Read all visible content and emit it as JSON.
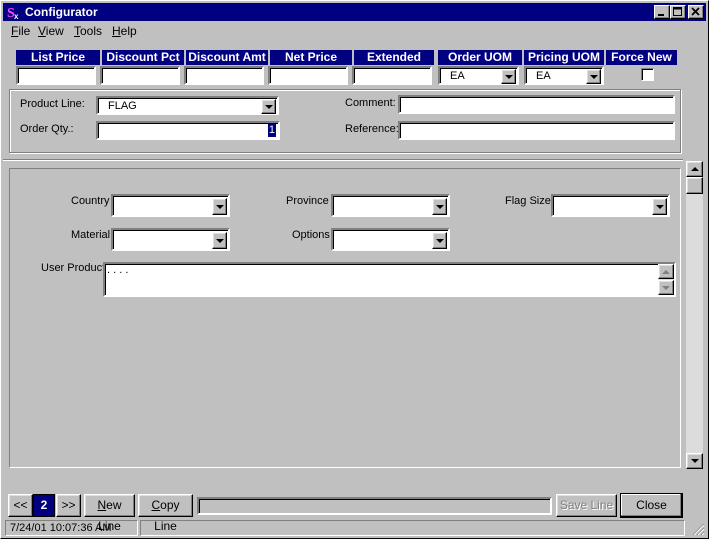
{
  "window": {
    "title": "Configurator",
    "minimize": "_",
    "maximize": "□",
    "close": "✕"
  },
  "menu": [
    {
      "label": "File",
      "accel": "F",
      "rest": "ile"
    },
    {
      "label": "View",
      "accel": "V",
      "rest": "iew"
    },
    {
      "label": "Tools",
      "accel": "T",
      "rest": "ools"
    },
    {
      "label": "Help",
      "accel": "H",
      "rest": "elp"
    }
  ],
  "line_header": {
    "list_price": "List Price",
    "discount_pct": "Discount Pct",
    "discount_amt": "Discount Amt",
    "net_price": "Net Price",
    "extended": "Extended",
    "order_uom": "Order UOM",
    "pricing_uom": "Pricing UOM",
    "force_new": "Force New"
  },
  "line_values": {
    "list_price": "",
    "discount_pct": "",
    "discount_amt": "",
    "net_price": "",
    "extended": "",
    "order_uom": "EA",
    "pricing_uom": "EA",
    "force_new": false
  },
  "product": {
    "product_line_label": "Product Line:",
    "product_line_value": "FLAG",
    "order_qty_label": "Order Qty.:",
    "order_qty_value": "1",
    "comment_label": "Comment:",
    "comment_value": "",
    "reference_label": "Reference:",
    "reference_value": ""
  },
  "options": {
    "country_label": "Country",
    "province_label": "Province",
    "flag_size_label": "Flag Size",
    "material_label": "Material",
    "options_label": "Options",
    "user_product_label": "User Product",
    "user_product_value": ". . . ."
  },
  "footer": {
    "prev": "<<",
    "page": "2",
    "next": ">>",
    "new_line": "New Line",
    "new_line_accel": "N",
    "copy_line": "Copy Line",
    "copy_line_accel": "C",
    "save_line": "Save Line",
    "close": "Close"
  },
  "status": {
    "timestamp": "7/24/01 10:07:36 AM"
  },
  "colors": {
    "title_bar": "#000080",
    "face": "#c0c0c0",
    "header_bg": "#000080",
    "page_highlight": "#000080"
  }
}
